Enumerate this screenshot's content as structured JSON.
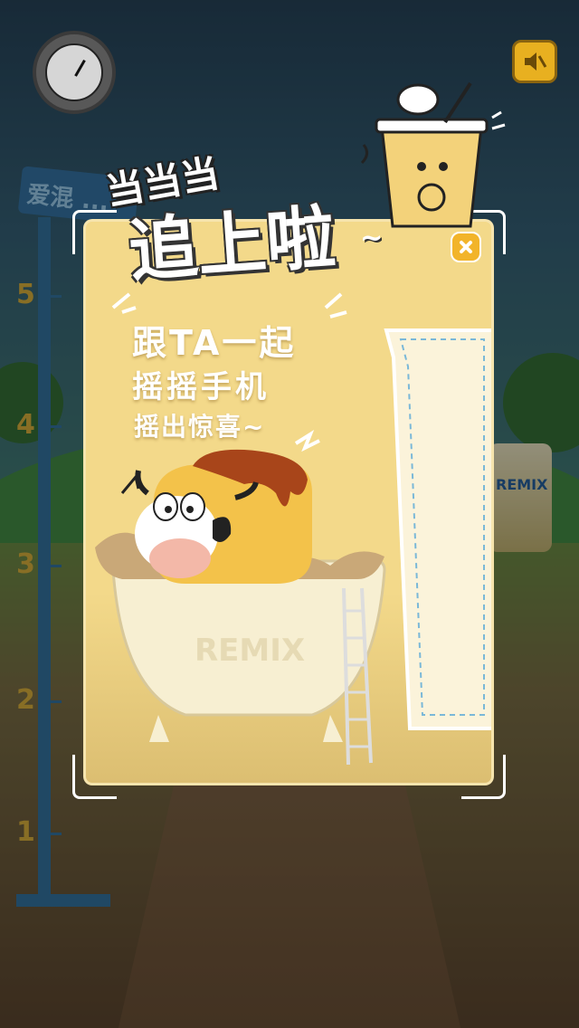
{
  "background": {
    "sign_text": "爱混 ...",
    "ruler_numbers": [
      "5",
      "4",
      "3",
      "2",
      "1"
    ],
    "can_label": "REMIX"
  },
  "controls": {
    "sound_icon": "mute-speaker-icon",
    "close_icon": "close-x-icon"
  },
  "popup": {
    "headline_small": "当当当",
    "headline_big": "追上啦",
    "headline_tilde": "~",
    "line1": "跟TA一起",
    "line2": "摇摇手机",
    "line3": "摇出惊喜~",
    "bathtub_brand": "REMIX"
  },
  "colors": {
    "panel": "#f3d98a",
    "accent": "#f2b42a",
    "pole": "#2e6f9b"
  }
}
